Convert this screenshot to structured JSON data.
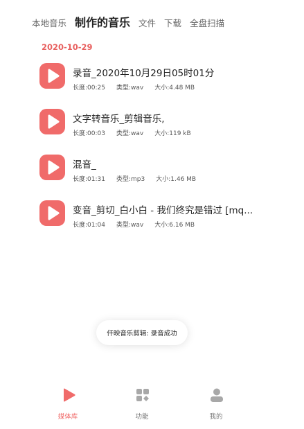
{
  "tabs": [
    {
      "label": "本地音乐"
    },
    {
      "label": "制作的音乐"
    },
    {
      "label": "文件"
    },
    {
      "label": "下载"
    },
    {
      "label": "全盘扫描"
    }
  ],
  "group_date": "2020-10-29",
  "items": [
    {
      "title": "录音_2020年10月29日05时01分",
      "length": "长度:00:25",
      "type": "类型:wav",
      "size": "大小:4.48 MB"
    },
    {
      "title": "文字转音乐_剪辑音乐,",
      "length": "长度:00:03",
      "type": "类型:wav",
      "size": "大小:119 kB"
    },
    {
      "title": "混音_",
      "length": "长度:01:31",
      "type": "类型:mp3",
      "size": "大小:1.46 MB"
    },
    {
      "title": "变音_剪切_白小白 - 我们终究是错过 [mq...",
      "length": "长度:01:04",
      "type": "类型:wav",
      "size": "大小:6.16 MB"
    }
  ],
  "toast": "仟映音乐剪辑: 录音成功",
  "bottom_nav": [
    {
      "label": "媒体库",
      "icon": "play-icon",
      "active": true
    },
    {
      "label": "功能",
      "icon": "grid-icon",
      "active": false
    },
    {
      "label": "我的",
      "icon": "user-icon",
      "active": false
    }
  ],
  "colors": {
    "accent": "#f06b6a",
    "date": "#e8605f",
    "inactive_icon": "#a8a8a8"
  }
}
